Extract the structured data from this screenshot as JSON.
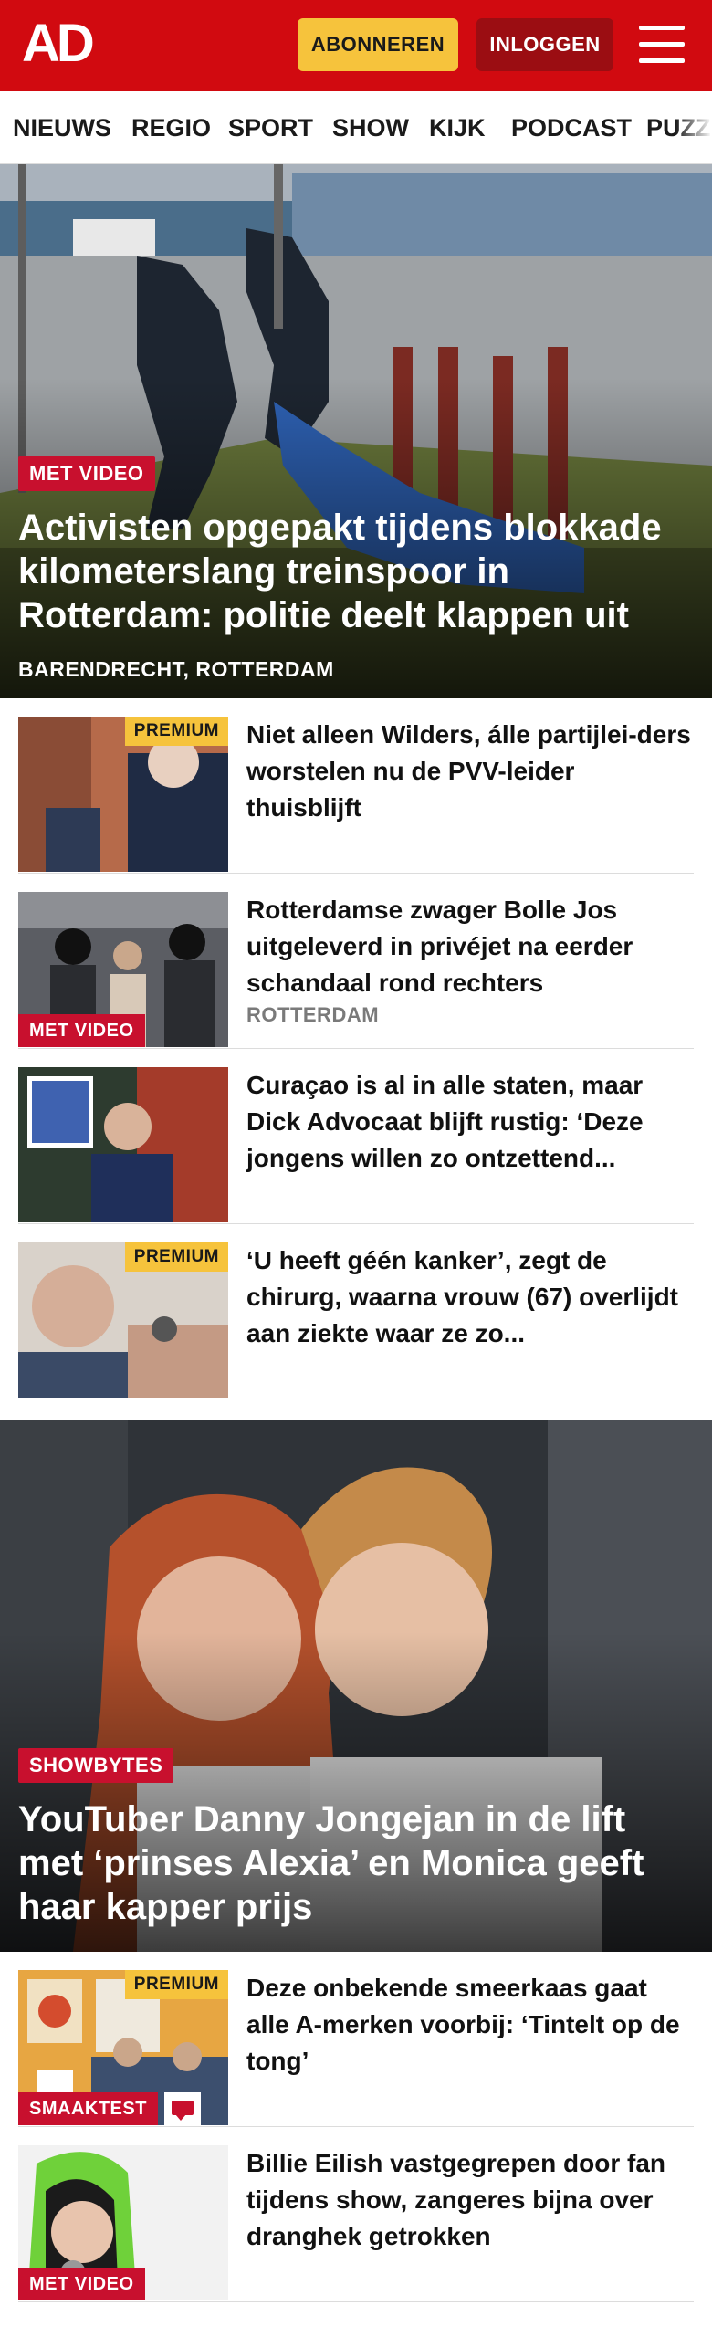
{
  "header": {
    "logo_text": "AD",
    "subscribe_label": "ABONNEREN",
    "login_label": "INLOGGEN",
    "brand_color": "#d10a10",
    "subscribe_color": "#f6c33c"
  },
  "nav": {
    "items": [
      "NIEUWS",
      "REGIO",
      "SPORT",
      "SHOW",
      "KIJK",
      "PODCAST",
      "PUZZ"
    ]
  },
  "hero1": {
    "badge": "MET VIDEO",
    "title": "Activisten opgepakt tijdens blokkade kilometerslang treinspoor in Rotterdam: politie deelt klappen uit",
    "location": "BARENDRECHT, ROTTERDAM"
  },
  "articles": [
    {
      "title": "Niet alleen Wilders, álle partijlei-ders worstelen nu de PVV-leider thuisblijft",
      "premium": "PREMIUM",
      "badge": "",
      "location": ""
    },
    {
      "title": "Rotterdamse zwager Bolle Jos uitgeleverd in privéjet na eerder schandaal rond rechters",
      "premium": "",
      "badge": "MET VIDEO",
      "location": "ROTTERDAM"
    },
    {
      "title": "Curaçao is al in alle staten, maar Dick Advocaat blijft rustig: ‘Deze jongens willen zo ontzettend...",
      "premium": "",
      "badge": "",
      "location": ""
    },
    {
      "title": "‘U heeft géén kanker’, zegt de chirurg, waarna vrouw (67) overlijdt aan ziekte waar ze zo...",
      "premium": "PREMIUM",
      "badge": "",
      "location": ""
    }
  ],
  "hero2": {
    "badge": "SHOWBYTES",
    "title": "YouTuber Danny Jongejan in de lift met ‘prinses Alexia’ en Monica geeft haar kapper prijs"
  },
  "articles2": [
    {
      "title": "Deze onbekende smeerkaas gaat alle A-merken voorbij: ‘Tintelt op de tong’",
      "premium": "PREMIUM",
      "badge": "SMAAKTEST",
      "icon": "comment-icon"
    },
    {
      "title": "Billie Eilish vastgegrepen door fan tijdens show, zangeres bijna over dranghek getrokken",
      "premium": "",
      "badge": "MET VIDEO"
    }
  ]
}
